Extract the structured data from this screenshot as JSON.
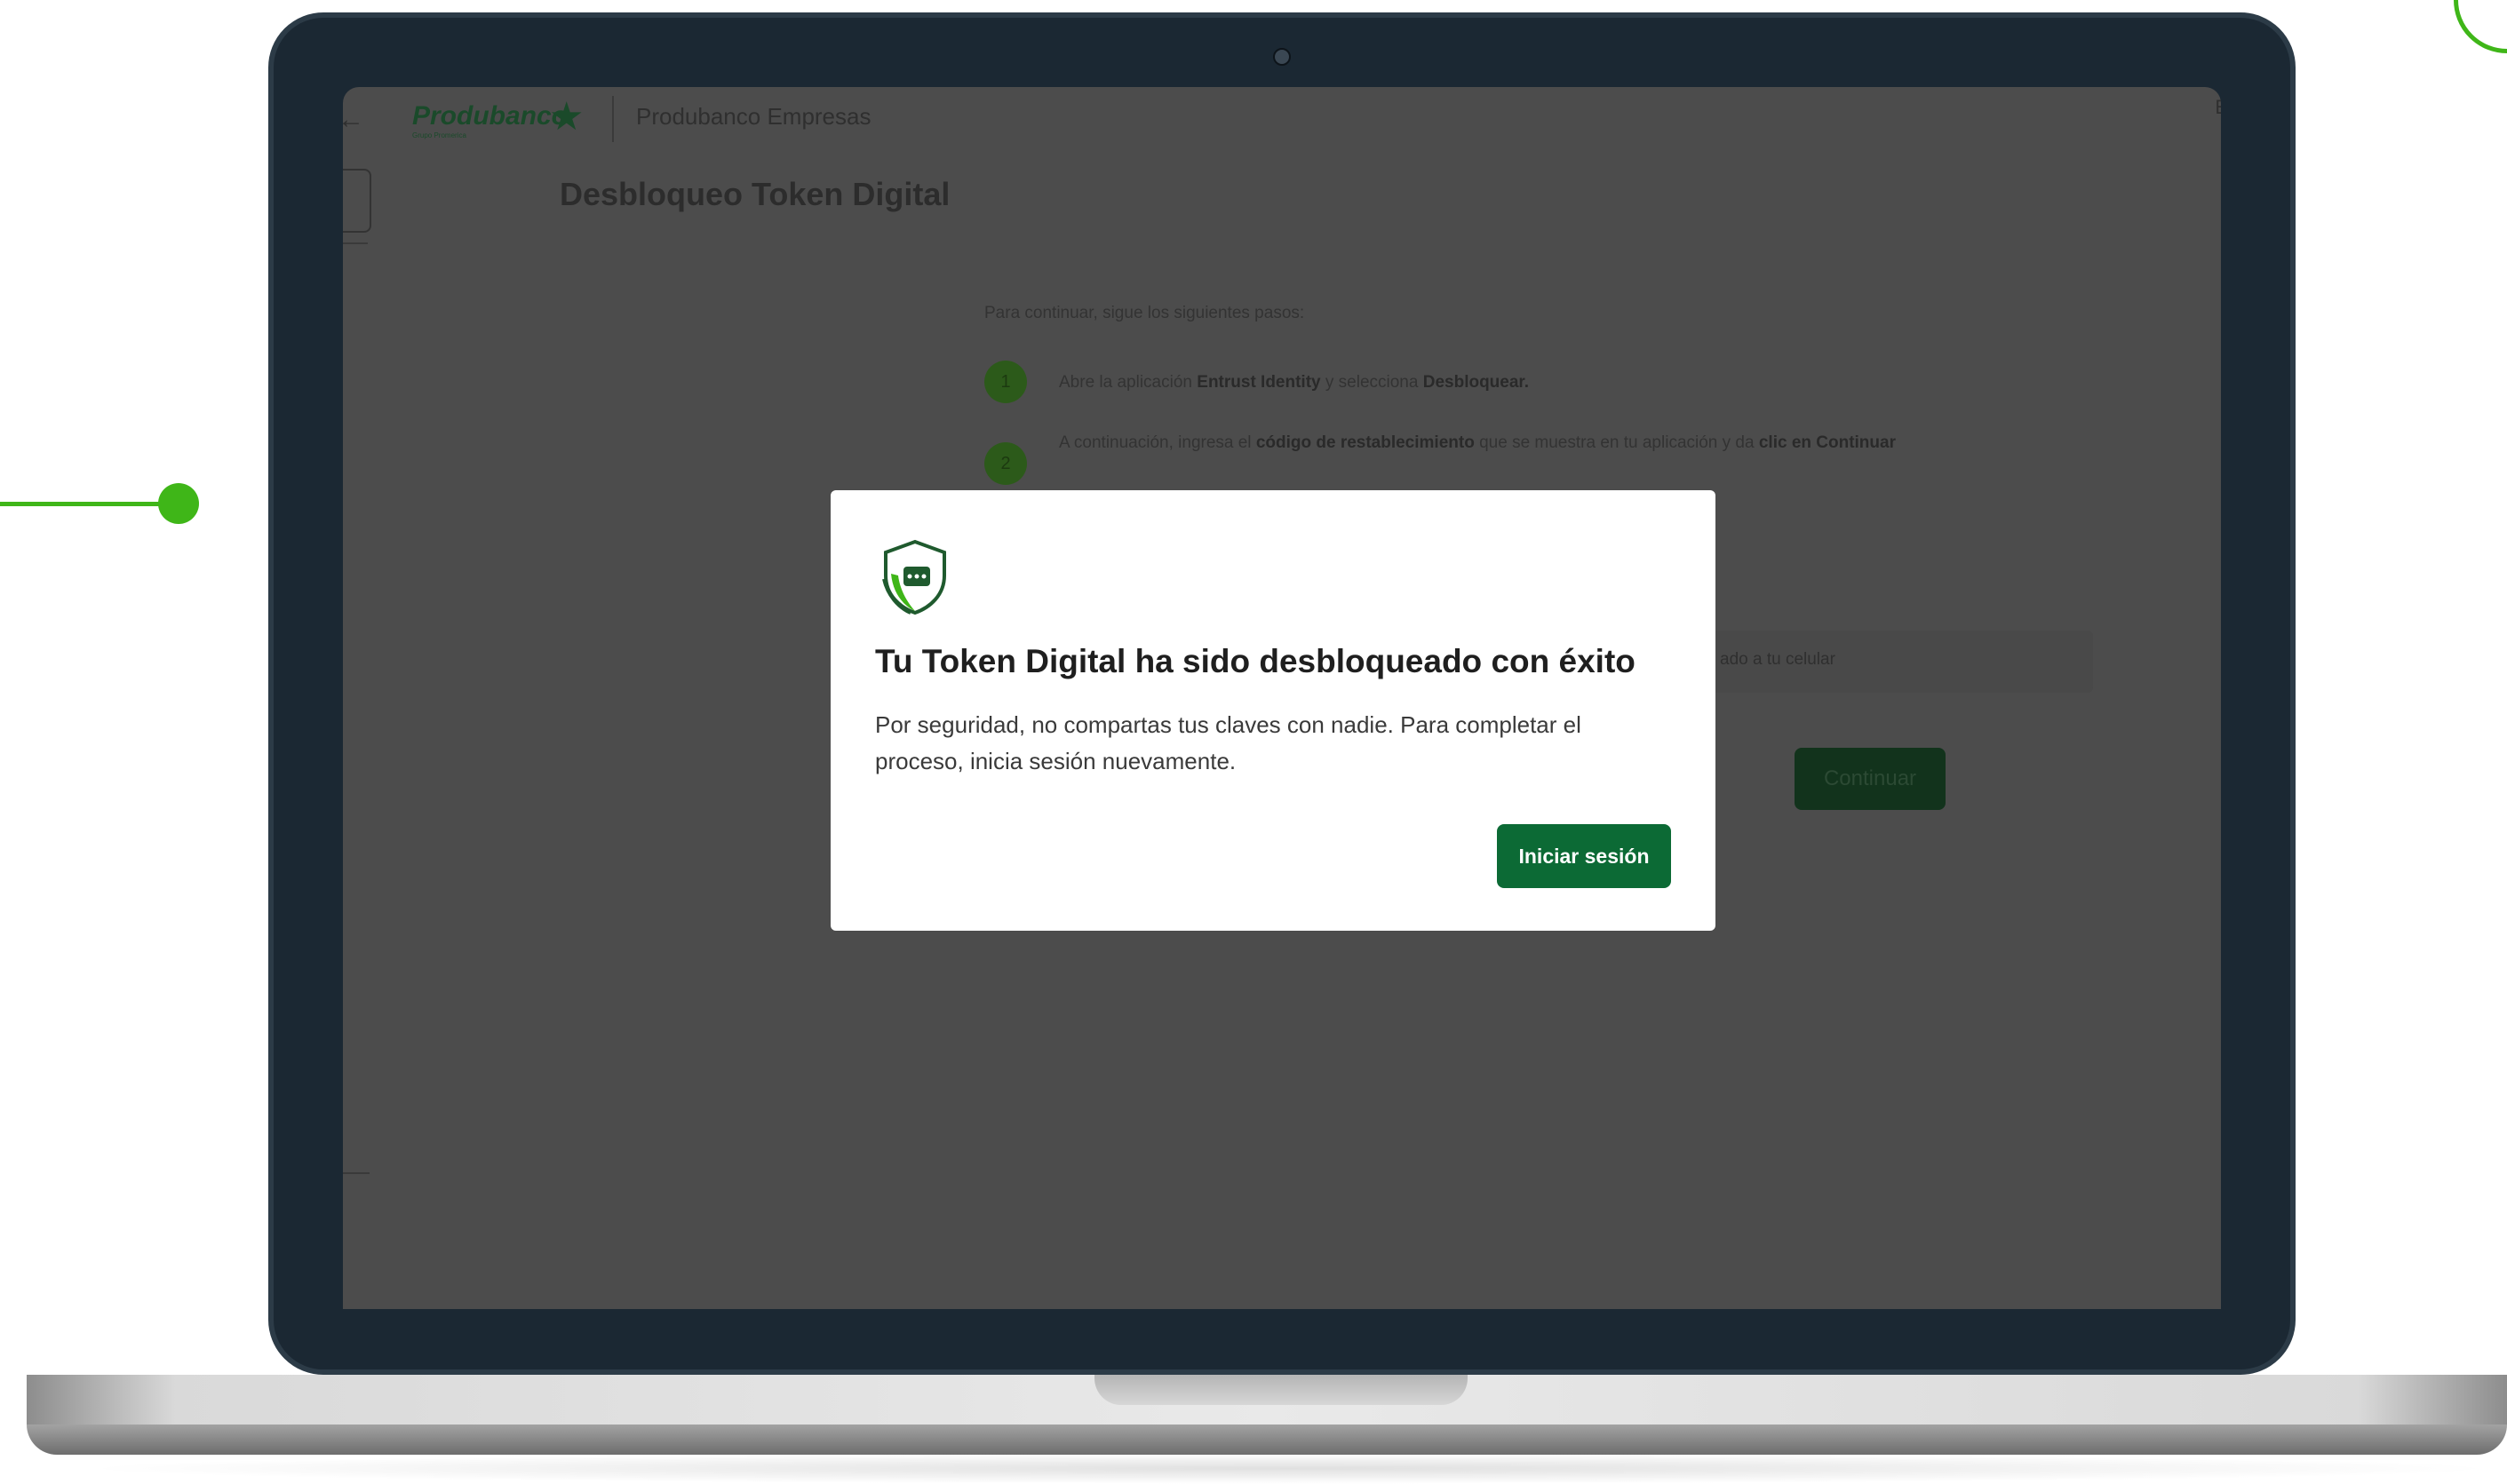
{
  "app": {
    "brand": "Produbanco",
    "brand_sub": "Grupo Promerica",
    "title": "Produbanco Empresas",
    "header_right": "E"
  },
  "page": {
    "title": "Desbloqueo Token Digital",
    "steps_intro": "Para continuar, sigue los siguientes pasos:",
    "steps": [
      {
        "number": "1",
        "text_a": "Abre la aplicación ",
        "text_b": "Entrust Identity",
        "text_c": " y selecciona ",
        "text_d": "Desbloquear."
      },
      {
        "number": "2",
        "text_a": "A continuación, ingresa el ",
        "text_b": "código de restablecimiento",
        "text_c": " que se muestra en tu aplicación y da ",
        "text_d": "clic en Continuar"
      }
    ],
    "input_placeholder": "ado a tu celular",
    "continue_label": "Continuar"
  },
  "modal": {
    "icon": "shield-check-icon",
    "title": "Tu Token Digital ha sido desbloqueado con éxito",
    "body": "Por seguridad, no compartas tus claves con nadie. Para completar el proceso, inicia sesión nuevamente.",
    "button_label": "Iniciar sesión"
  },
  "colors": {
    "accent_green": "#3fb618",
    "button_green": "#0c6a35",
    "overlay": "#4c4c4c",
    "bezel": "#1b2833"
  }
}
